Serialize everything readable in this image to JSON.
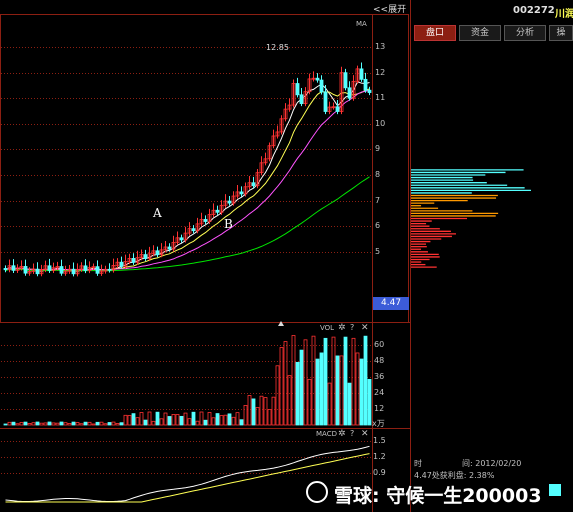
{
  "header": {
    "expand_label": "<<展开",
    "stock_code": "002272",
    "stock_name_partial": "川润",
    "tabs": [
      {
        "label": "盘口",
        "active": true
      },
      {
        "label": "资金",
        "active": false
      },
      {
        "label": "分析",
        "active": false
      },
      {
        "label": "操",
        "active": false
      }
    ]
  },
  "price_axis": [
    "13",
    "12",
    "11",
    "10",
    "9",
    "8",
    "7",
    "6",
    "5"
  ],
  "price_indicator": "MA",
  "high_marker": "12.85",
  "annotations": {
    "a": "A",
    "b": "B"
  },
  "current_price_tag": "4.47",
  "volume_panel": {
    "title": "VOL",
    "axis": [
      "60",
      "48",
      "36",
      "24",
      "12"
    ],
    "unit": "x万"
  },
  "macd_panel": {
    "title": "MACD",
    "axis": [
      "1.5",
      "1.2",
      "0.9"
    ]
  },
  "info": {
    "time_label": "时",
    "time_value": "间: 2012/02/20",
    "profit_line": "4.47处获利盘: 2.38%"
  },
  "watermark": "雪球: 守候一生200003",
  "colors": {
    "up": "#ff3232",
    "down": "#54ffff",
    "ma5": "#ffffff",
    "ma10": "#ffff54",
    "ma20": "#ff54ff",
    "ma60": "#00e600",
    "grid": "#8c1f12",
    "tag": "#3c5cd8"
  }
}
